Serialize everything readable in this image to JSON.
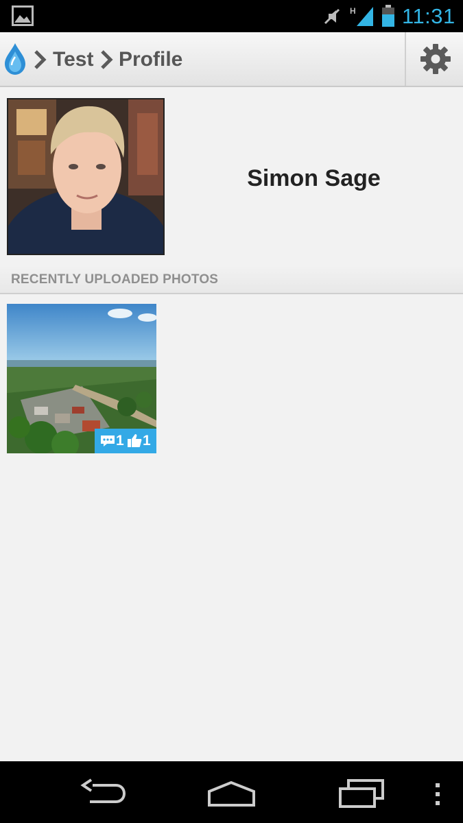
{
  "status_bar": {
    "time": "11:31",
    "network_label": "H",
    "icons": [
      "gallery-icon",
      "mute-icon",
      "signal-icon",
      "battery-icon"
    ]
  },
  "action_bar": {
    "logo_icon": "drop-logo-icon",
    "breadcrumbs": [
      "Test",
      "Profile"
    ],
    "settings_icon": "gear-icon"
  },
  "profile": {
    "name": "Simon Sage",
    "avatar_icon": "avatar-photo"
  },
  "photos_section": {
    "title": "RECENTLY UPLOADED PHOTOS",
    "photos": [
      {
        "comments": "1",
        "likes": "1"
      }
    ]
  },
  "nav_bar": {
    "buttons": [
      "back-icon",
      "home-icon",
      "recents-icon",
      "menu-icon"
    ]
  },
  "colors": {
    "accent": "#33b5e5",
    "badge": "#33a9e6",
    "background": "#f2f2f2",
    "title_text": "#565656",
    "section_text": "#8f8f8f"
  }
}
